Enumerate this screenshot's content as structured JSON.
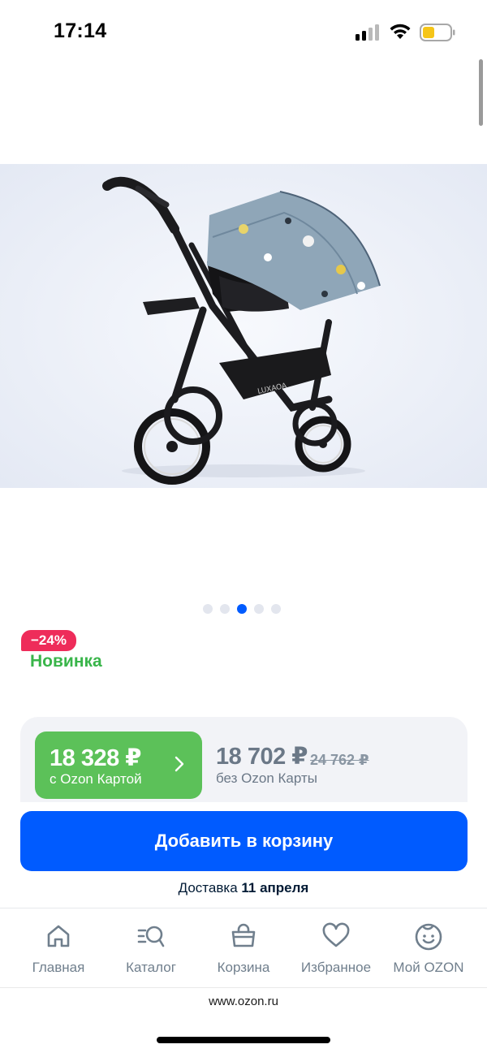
{
  "status_bar": {
    "time": "17:14"
  },
  "product": {
    "gallery": {
      "dots": 5,
      "active_index": 2
    },
    "discount_badge": "−24%",
    "new_label": "Новинка"
  },
  "price": {
    "ozon_card_amount": "18 328 ₽",
    "ozon_card_caption": "с Ozon Картой",
    "regular_amount": "18 702 ₽",
    "old_amount": "24 762 ₽",
    "regular_caption": "без Ozon Карты"
  },
  "cart": {
    "add_button": "Добавить в корзину",
    "delivery_prefix": "Доставка ",
    "delivery_date": "11 апреля"
  },
  "bottom_nav": [
    {
      "label": "Главная",
      "icon": "home-icon"
    },
    {
      "label": "Каталог",
      "icon": "catalog-search-icon"
    },
    {
      "label": "Корзина",
      "icon": "cart-icon"
    },
    {
      "label": "Избранное",
      "icon": "heart-icon"
    },
    {
      "label": "Мой OZON",
      "icon": "profile-smile-icon"
    }
  ],
  "browser": {
    "url": "www.ozon.ru"
  },
  "colors": {
    "accent": "#005bff",
    "green": "#5cc159",
    "badge": "#ee2c5a",
    "nav_icon": "#707f8d"
  }
}
